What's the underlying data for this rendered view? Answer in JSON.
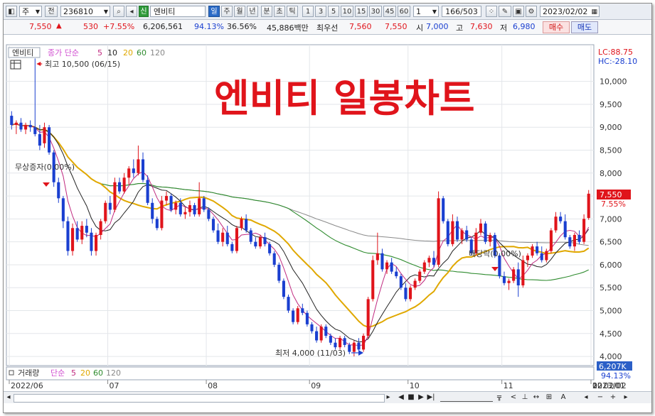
{
  "toolbar": {
    "type_label": "주",
    "prev_label": "전",
    "code": "236810",
    "badge": "신",
    "name": "엔비티",
    "periods": [
      "일",
      "주",
      "월",
      "년",
      "분",
      "초",
      "틱"
    ],
    "active_period": "일",
    "intervals": [
      "1",
      "3",
      "5",
      "10",
      "15",
      "30",
      "45",
      "60"
    ],
    "count": "1",
    "pager": "166/503",
    "date": "2023/02/02"
  },
  "quote": {
    "price": "7,550",
    "arrow": "▲",
    "change": "530",
    "change_pct": "+7.55%",
    "volume": "6,206,561",
    "vol_ratio": "94.13%",
    "turnover": "36.56%",
    "amount": "45,886백만",
    "label_best": "최우선",
    "best_value": "7,560",
    "best_value2": "7,550",
    "label_open": "시",
    "open": "7,000",
    "label_high": "고",
    "high": "7,630",
    "label_low": "저",
    "low": "6,980",
    "buy_label": "매수",
    "sell_label": "매도"
  },
  "chart_data": {
    "type": "candlestick",
    "title": "엔비티 일봉차트",
    "legend": {
      "name": "엔비티",
      "ma_label": "종가 단순",
      "ma_periods": [
        "5",
        "10",
        "20",
        "60",
        "120"
      ]
    },
    "lc": "LC:88.75",
    "hc": "HC:-28.10",
    "y_ticks": [
      4000,
      4500,
      5000,
      5500,
      6000,
      6500,
      7000,
      7500,
      8000,
      8500,
      9000,
      9500,
      10000
    ],
    "y_tick_labels": [
      "4,000",
      "4,500",
      "5,000",
      "5,500",
      "6,000",
      "6,500",
      "7,000",
      "7,500",
      "8,000",
      "8,500",
      "9,000",
      "9,500",
      "10,000"
    ],
    "ylim": [
      3800,
      10800
    ],
    "x_labels": [
      "2022/06",
      "07",
      "08",
      "09",
      "10",
      "11",
      "12",
      "2023/01",
      "02"
    ],
    "right_axis_date": "02/02",
    "annotations": {
      "high": "최고 10,500 (06/15)",
      "low": "최저 4,000 (11/03)",
      "rights": "무상증자(0.00%)",
      "dividend": "배당락(0.00%)"
    },
    "last_price_label": "7,550",
    "last_pct_label": "7.55%",
    "volume_panel": {
      "name": "거래량",
      "ma_label": "단순",
      "ma_periods": [
        "5",
        "20",
        "60",
        "120"
      ],
      "last_volume": "6,207K",
      "vol_pct": "94.13%"
    },
    "candles": [
      [
        9250,
        9350,
        8950,
        9050
      ],
      [
        9050,
        9150,
        8850,
        9100
      ],
      [
        9100,
        9200,
        8900,
        8950
      ],
      [
        8950,
        9100,
        8850,
        9050
      ],
      [
        9050,
        9150,
        8900,
        9000
      ],
      [
        9000,
        10500,
        8800,
        8850
      ],
      [
        8850,
        9050,
        8500,
        8600
      ],
      [
        8650,
        9100,
        8550,
        9000
      ],
      [
        9000,
        9050,
        8400,
        8450
      ],
      [
        8450,
        8500,
        7700,
        7800
      ],
      [
        7800,
        7900,
        7350,
        7450
      ],
      [
        7450,
        7500,
        6800,
        6950
      ],
      [
        6950,
        7050,
        6200,
        6300
      ],
      [
        6300,
        6900,
        6200,
        6800
      ],
      [
        6800,
        6950,
        6500,
        6550
      ],
      [
        6550,
        6950,
        6450,
        6850
      ],
      [
        6850,
        7000,
        6600,
        6700
      ],
      [
        6700,
        6800,
        6200,
        6300
      ],
      [
        6300,
        6700,
        6200,
        6650
      ],
      [
        6650,
        7000,
        6550,
        6950
      ],
      [
        6950,
        7400,
        6900,
        7350
      ],
      [
        7350,
        7500,
        7100,
        7200
      ],
      [
        7200,
        7900,
        7150,
        7800
      ],
      [
        7800,
        7900,
        7550,
        7600
      ],
      [
        7600,
        8000,
        7550,
        7900
      ],
      [
        7900,
        8150,
        7750,
        8100
      ],
      [
        8100,
        8300,
        7900,
        8000
      ],
      [
        8000,
        8600,
        7950,
        8300
      ],
      [
        8300,
        8450,
        7800,
        7850
      ],
      [
        7850,
        7950,
        7300,
        7350
      ],
      [
        7350,
        7450,
        6900,
        7000
      ],
      [
        7000,
        7050,
        6750,
        6800
      ],
      [
        6800,
        7500,
        6750,
        7400
      ],
      [
        7400,
        7600,
        7300,
        7500
      ],
      [
        7500,
        7550,
        7150,
        7200
      ],
      [
        7200,
        7400,
        7100,
        7350
      ],
      [
        7350,
        7450,
        7050,
        7100
      ],
      [
        7100,
        7250,
        7000,
        7150
      ],
      [
        7150,
        7400,
        7050,
        7300
      ],
      [
        7300,
        7350,
        7050,
        7100
      ],
      [
        7100,
        7800,
        7050,
        7450
      ],
      [
        7450,
        7500,
        7150,
        7200
      ],
      [
        7200,
        7250,
        6950,
        7000
      ],
      [
        7000,
        7050,
        6700,
        6750
      ],
      [
        6750,
        6900,
        6450,
        6500
      ],
      [
        6500,
        6800,
        6400,
        6700
      ],
      [
        6700,
        6850,
        6400,
        6450
      ],
      [
        6450,
        6500,
        6250,
        6300
      ],
      [
        6300,
        6850,
        6250,
        6800
      ],
      [
        6800,
        7050,
        6750,
        7000
      ],
      [
        7000,
        7100,
        6700,
        6750
      ],
      [
        6750,
        6800,
        6450,
        6500
      ],
      [
        6500,
        6600,
        6350,
        6400
      ],
      [
        6400,
        6650,
        6350,
        6600
      ],
      [
        6600,
        6700,
        6400,
        6450
      ],
      [
        6450,
        6500,
        6200,
        6250
      ],
      [
        6250,
        6300,
        5950,
        6000
      ],
      [
        6000,
        6050,
        5600,
        5650
      ],
      [
        5650,
        5700,
        5250,
        5300
      ],
      [
        5300,
        5350,
        4950,
        5000
      ],
      [
        5000,
        5050,
        4700,
        4750
      ],
      [
        4750,
        5100,
        4700,
        5050
      ],
      [
        5050,
        5150,
        4900,
        4950
      ],
      [
        4950,
        5000,
        4650,
        4700
      ],
      [
        4700,
        4750,
        4500,
        4550
      ],
      [
        4550,
        4650,
        4300,
        4350
      ],
      [
        4350,
        4700,
        4300,
        4650
      ],
      [
        4650,
        4700,
        4400,
        4450
      ],
      [
        4450,
        4500,
        4250,
        4300
      ],
      [
        4300,
        4400,
        4150,
        4200
      ],
      [
        4200,
        4450,
        4150,
        4400
      ],
      [
        4400,
        4450,
        4200,
        4250
      ],
      [
        4250,
        4300,
        4050,
        4100
      ],
      [
        4100,
        4350,
        4000,
        4300
      ],
      [
        4300,
        4400,
        4100,
        4150
      ],
      [
        4150,
        4500,
        4100,
        4450
      ],
      [
        4450,
        5300,
        4400,
        5250
      ],
      [
        5250,
        6200,
        5200,
        6100
      ],
      [
        6100,
        6700,
        6000,
        6250
      ],
      [
        6250,
        6350,
        5850,
        5900
      ],
      [
        5900,
        6100,
        5800,
        6050
      ],
      [
        6050,
        6150,
        5800,
        5850
      ],
      [
        5850,
        5950,
        5700,
        5750
      ],
      [
        5750,
        5800,
        5450,
        5500
      ],
      [
        5500,
        5600,
        5200,
        5250
      ],
      [
        5250,
        5550,
        5200,
        5500
      ],
      [
        5500,
        5700,
        5450,
        5650
      ],
      [
        5650,
        5900,
        5600,
        5850
      ],
      [
        5850,
        6100,
        5800,
        6050
      ],
      [
        6050,
        6200,
        5950,
        6150
      ],
      [
        6150,
        6300,
        5950,
        6000
      ],
      [
        6000,
        7600,
        5950,
        7450
      ],
      [
        7450,
        7500,
        6900,
        6950
      ],
      [
        6950,
        7000,
        6400,
        6450
      ],
      [
        6450,
        7100,
        6400,
        6950
      ],
      [
        6950,
        7050,
        6500,
        6550
      ],
      [
        6550,
        6800,
        6450,
        6750
      ],
      [
        6750,
        6850,
        6500,
        6550
      ],
      [
        6550,
        6600,
        6200,
        6250
      ],
      [
        6250,
        6800,
        6200,
        6700
      ],
      [
        6700,
        7000,
        6650,
        6900
      ],
      [
        6900,
        6950,
        6450,
        6500
      ],
      [
        6500,
        6700,
        6400,
        6650
      ],
      [
        6650,
        6700,
        6150,
        6200
      ],
      [
        6200,
        6250,
        5700,
        5750
      ],
      [
        5750,
        5850,
        5550,
        5600
      ],
      [
        5600,
        5700,
        5450,
        5650
      ],
      [
        5650,
        5950,
        5600,
        5900
      ],
      [
        5900,
        6050,
        5300,
        5550
      ],
      [
        5550,
        6200,
        5500,
        6100
      ],
      [
        6100,
        6250,
        5950,
        6200
      ],
      [
        6200,
        6450,
        6150,
        6400
      ],
      [
        6400,
        6500,
        6200,
        6250
      ],
      [
        6250,
        6400,
        6050,
        6100
      ],
      [
        6100,
        6350,
        6050,
        6300
      ],
      [
        6300,
        6800,
        6250,
        6750
      ],
      [
        6750,
        7150,
        6700,
        7050
      ],
      [
        7050,
        7150,
        6900,
        6950
      ],
      [
        6950,
        7100,
        6550,
        6600
      ],
      [
        6600,
        6650,
        6350,
        6400
      ],
      [
        6400,
        6700,
        6300,
        6650
      ],
      [
        6650,
        6750,
        6450,
        6500
      ],
      [
        6500,
        7100,
        6450,
        7000
      ],
      [
        7020,
        7630,
        6980,
        7550
      ]
    ]
  }
}
